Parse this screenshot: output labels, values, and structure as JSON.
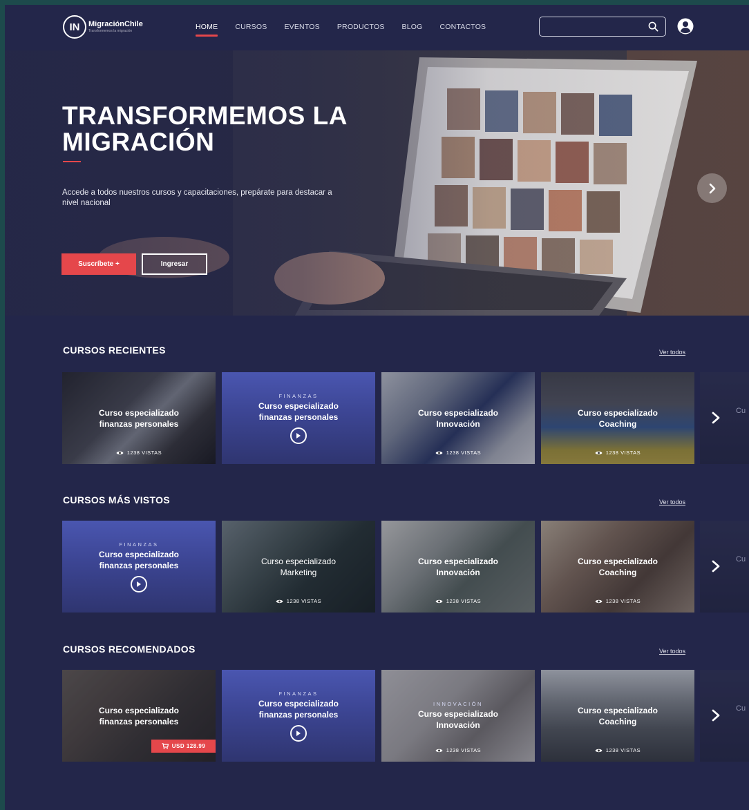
{
  "brand": {
    "badge": "IN",
    "name": "MigraciónChile",
    "tagline": "Transformemos la migración"
  },
  "nav": {
    "items": [
      {
        "label": "HOME",
        "active": true
      },
      {
        "label": "CURSOS"
      },
      {
        "label": "EVENTOS"
      },
      {
        "label": "PRODUCTOS"
      },
      {
        "label": "BLOG"
      },
      {
        "label": "CONTACTOS"
      }
    ]
  },
  "search": {
    "value": "",
    "placeholder": ""
  },
  "hero": {
    "title": "TRANSFORMEMOS LA MIGRACIÓN",
    "description": "Accede a todos nuestros cursos y capacitaciones, prepárate para destacar a nivel nacional",
    "subscribe_label": "Suscríbete +",
    "login_label": "Ingresar"
  },
  "see_all_label": "Ver todos",
  "sections": [
    {
      "title": "CURSOS RECIENTES",
      "cards": [
        {
          "title1": "Curso especializado",
          "title2": "finanzas personales",
          "views": "1238 VISTAS"
        },
        {
          "category": "FINANZAS",
          "title1": "Curso especializado",
          "title2": "finanzas personales"
        },
        {
          "title1": "Curso especializado",
          "title2": "Innovación",
          "views": "1238 VISTAS"
        },
        {
          "title1": "Curso especializado",
          "title2": "Coaching",
          "views": "1238 VISTAS"
        }
      ],
      "partial_label": "Cu"
    },
    {
      "title": "CURSOS MÁS VISTOS",
      "cards": [
        {
          "category": "FINANZAS",
          "title1": "Curso especializado",
          "title2": "finanzas personales"
        },
        {
          "title1": "Curso especializado",
          "title2": "Marketing",
          "views": "1238 VISTAS"
        },
        {
          "title1": "Curso especializado",
          "title2": "Innovación",
          "views": "1238 VISTAS"
        },
        {
          "title1": "Curso especializado",
          "title2": "Coaching",
          "views": "1238 VISTAS"
        }
      ],
      "partial_label": "Cu"
    },
    {
      "title": "CURSOS RECOMENDADOS",
      "cards": [
        {
          "title1": "Curso especializado",
          "title2": "finanzas personales",
          "price": "USD 128.99"
        },
        {
          "category": "FINANZAS",
          "title1": "Curso especializado",
          "title2": "finanzas personales"
        },
        {
          "category": "INNOVACIÓN",
          "title1": "Curso especializado",
          "title2": "Innovación",
          "views": "1238 VISTAS"
        },
        {
          "title1": "Curso especializado",
          "title2": "Coaching",
          "views": "1238 VISTAS"
        }
      ],
      "partial_label": "Cu"
    }
  ],
  "colors": {
    "background": "#23264a",
    "accent": "#e5474b",
    "frame": "#1d4a4c"
  },
  "icons": [
    "search-icon",
    "user-icon",
    "chevron-right-icon",
    "play-icon",
    "eye-icon",
    "cart-icon"
  ]
}
